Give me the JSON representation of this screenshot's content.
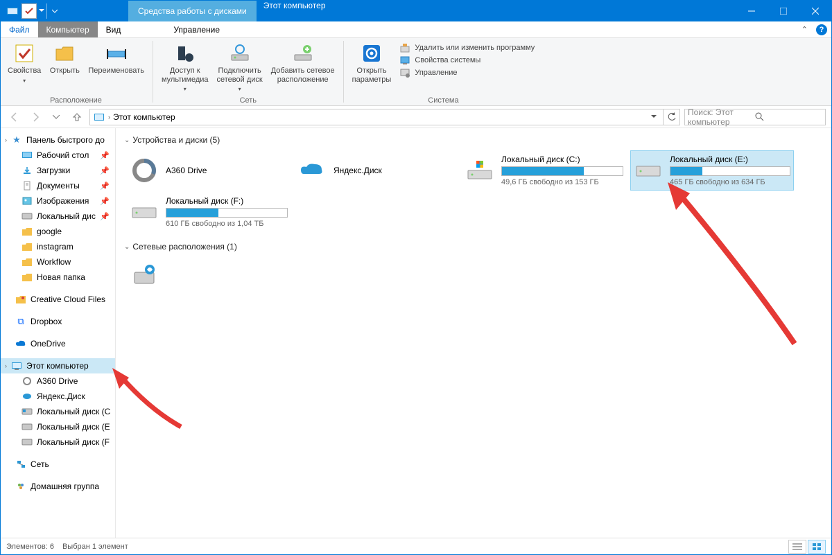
{
  "titlebar": {
    "context_tab": "Средства работы с дисками",
    "title": "Этот компьютер"
  },
  "ribbon_tabs": {
    "file": "Файл",
    "computer": "Компьютер",
    "view": "Вид",
    "manage": "Управление"
  },
  "ribbon": {
    "properties": "Свойства",
    "open": "Открыть",
    "rename": "Переименовать",
    "group_location": "Расположение",
    "media_access": "Доступ к\nмультимедиа",
    "connect_net": "Подключить\nсетевой диск",
    "add_net": "Добавить сетевое\nрасположение",
    "group_net": "Сеть",
    "open_settings": "Открыть\nпараметры",
    "uninstall": "Удалить или изменить программу",
    "sys_props": "Свойства системы",
    "manage": "Управление",
    "group_system": "Система"
  },
  "address": {
    "crumb": "Этот компьютер"
  },
  "search": {
    "placeholder": "Поиск: Этот компьютер"
  },
  "nav": {
    "quick_access": "Панель быстрого до",
    "desktop": "Рабочий стол",
    "downloads": "Загрузки",
    "documents": "Документы",
    "pictures": "Изображения",
    "local_disk": "Локальный дис",
    "google": "google",
    "instagram": "instagram",
    "workflow": "Workflow",
    "new_folder": "Новая папка",
    "cc_files": "Creative Cloud Files",
    "dropbox": "Dropbox",
    "onedrive": "OneDrive",
    "this_pc": "Этот компьютер",
    "a360": "A360 Drive",
    "yandex": "Яндекс.Диск",
    "disk_c": "Локальный диск (C",
    "disk_e": "Локальный диск (E",
    "disk_f": "Локальный диск (F",
    "network": "Сеть",
    "homegroup": "Домашняя группа"
  },
  "content": {
    "group_devices": "Устройства и диски (5)",
    "group_netloc": "Сетевые расположения (1)",
    "a360": {
      "name": "A360 Drive"
    },
    "yandex": {
      "name": "Яндекс.Диск"
    },
    "disk_c": {
      "name": "Локальный диск (С:)",
      "stats": "49,6 ГБ свободно из 153 ГБ",
      "fill": 68
    },
    "disk_e": {
      "name": "Локальный диск (Е:)",
      "stats": "465 ГБ свободно из 634 ГБ",
      "fill": 27
    },
    "disk_f": {
      "name": "Локальный диск (F:)",
      "stats": "610 ГБ свободно из 1,04 ТБ",
      "fill": 43
    }
  },
  "status": {
    "count": "Элементов: 6",
    "selected": "Выбран 1 элемент"
  }
}
